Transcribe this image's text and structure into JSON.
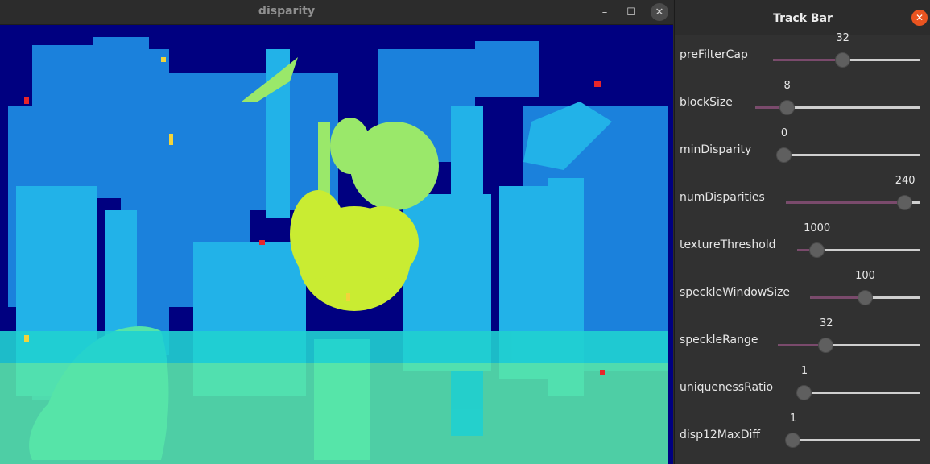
{
  "disparity_window": {
    "title": "disparity",
    "minimize_glyph": "–",
    "maximize_glyph": "☐",
    "close_glyph": "✕"
  },
  "trackbar_window": {
    "title": "Track Bar",
    "minimize_glyph": "–",
    "close_glyph": "✕",
    "trackbars": [
      {
        "label": "preFilterCap",
        "value": "32",
        "level": 0.47
      },
      {
        "label": "blockSize",
        "value": "8",
        "level": 0.16
      },
      {
        "label": "minDisparity",
        "value": "0",
        "level": 0.0
      },
      {
        "label": "numDisparities",
        "value": "240",
        "level": 0.94
      },
      {
        "label": "textureThreshold",
        "value": "1000",
        "level": 0.11
      },
      {
        "label": "speckleWindowSize",
        "value": "100",
        "level": 0.5
      },
      {
        "label": "speckleRange",
        "value": "32",
        "level": 0.32
      },
      {
        "label": "uniquenessRatio",
        "value": "1",
        "level": 0.0
      },
      {
        "label": "disp12MaxDiff",
        "value": "1",
        "level": 0.0
      }
    ]
  },
  "colors": {
    "background_far": "#000080",
    "disparity_low": "#1e90ff",
    "disparity_mid": "#20d0d0",
    "disparity_high": "#c8f020",
    "trackbar_fill": "#7a4a6c",
    "close_button": "#e95420"
  }
}
